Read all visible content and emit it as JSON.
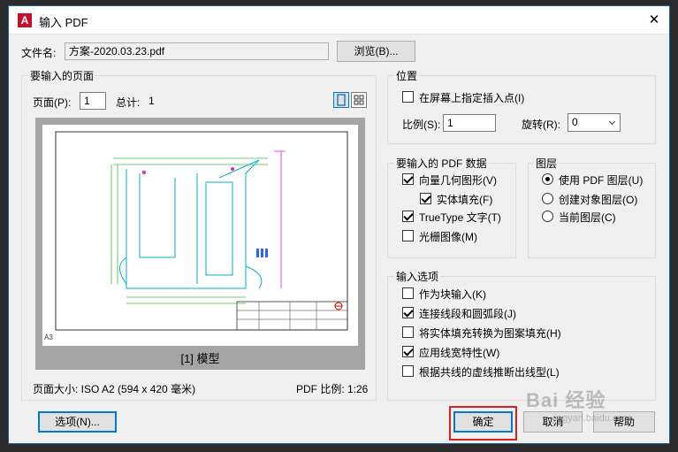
{
  "window": {
    "title": "输入 PDF",
    "app_icon_letter": "A",
    "close_glyph": "✕"
  },
  "file": {
    "label": "文件名:",
    "value": "方案-2020.03.23.pdf",
    "browse_label": "浏览(B)..."
  },
  "pages": {
    "group_title": "要输入的页面",
    "page_label": "页面(P):",
    "page_value": "1",
    "total_label": "总计:",
    "total_value": "1",
    "preview_caption": "[1] 模型",
    "page_size": "页面大小: ISO A2 (594 x 420 毫米)",
    "pdf_scale": "PDF 比例: 1:26",
    "sheet_size_tag": "A3"
  },
  "position": {
    "group_title": "位置",
    "specify_on_screen_label": "在屏幕上指定插入点(I)",
    "specify_on_screen_checked": false,
    "scale_label": "比例(S):",
    "scale_value": "1",
    "rotation_label": "旋转(R):",
    "rotation_value": "0"
  },
  "pdf_data": {
    "group_title": "要输入的 PDF 数据",
    "items": [
      {
        "label": "向量几何图形(V)",
        "checked": true
      },
      {
        "label": "实体填充(F)",
        "checked": true
      },
      {
        "label": "TrueType 文字(T)",
        "checked": true
      },
      {
        "label": "光栅图像(M)",
        "checked": false
      }
    ]
  },
  "layers": {
    "group_title": "图层",
    "items": [
      {
        "label": "使用 PDF 图层(U)",
        "checked": true
      },
      {
        "label": "创建对象图层(O)",
        "checked": false
      },
      {
        "label": "当前图层(C)",
        "checked": false
      }
    ]
  },
  "import_options": {
    "group_title": "输入选项",
    "items": [
      {
        "label": "作为块输入(K)",
        "checked": false
      },
      {
        "label": "连接线段和圆弧段(J)",
        "checked": true
      },
      {
        "label": "将实体填充转换为图案填充(H)",
        "checked": false
      },
      {
        "label": "应用线宽特性(W)",
        "checked": true
      },
      {
        "label": "根据共线的虚线推断出线型(L)",
        "checked": false
      }
    ]
  },
  "buttons": {
    "options": "选项(N)...",
    "ok": "确定",
    "cancel": "取消",
    "help": "帮助"
  },
  "watermark": {
    "text": "Bai 经验",
    "sub": "jingyan.baidu.com"
  },
  "colors": {
    "accent": "#0078d7",
    "highlight": "#e0201d",
    "title_border": "#1c5f9e"
  }
}
